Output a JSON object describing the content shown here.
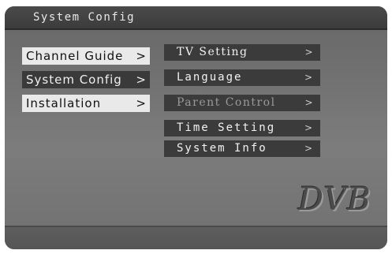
{
  "header": {
    "title": "System  Config"
  },
  "left_menu": [
    {
      "label": "Channel Guide",
      "chevron": ">"
    },
    {
      "label": "System Config",
      "chevron": ">"
    },
    {
      "label": "Installation",
      "chevron": ">"
    }
  ],
  "right_menu": [
    {
      "label": "TV Setting",
      "chevron": ">"
    },
    {
      "label": "Language",
      "chevron": ">"
    },
    {
      "label": "Parent Control",
      "chevron": ">"
    },
    {
      "label": "Time Setting",
      "chevron": ">"
    },
    {
      "label": "System Info",
      "chevron": ">"
    }
  ],
  "logo": {
    "text": "DVB"
  }
}
